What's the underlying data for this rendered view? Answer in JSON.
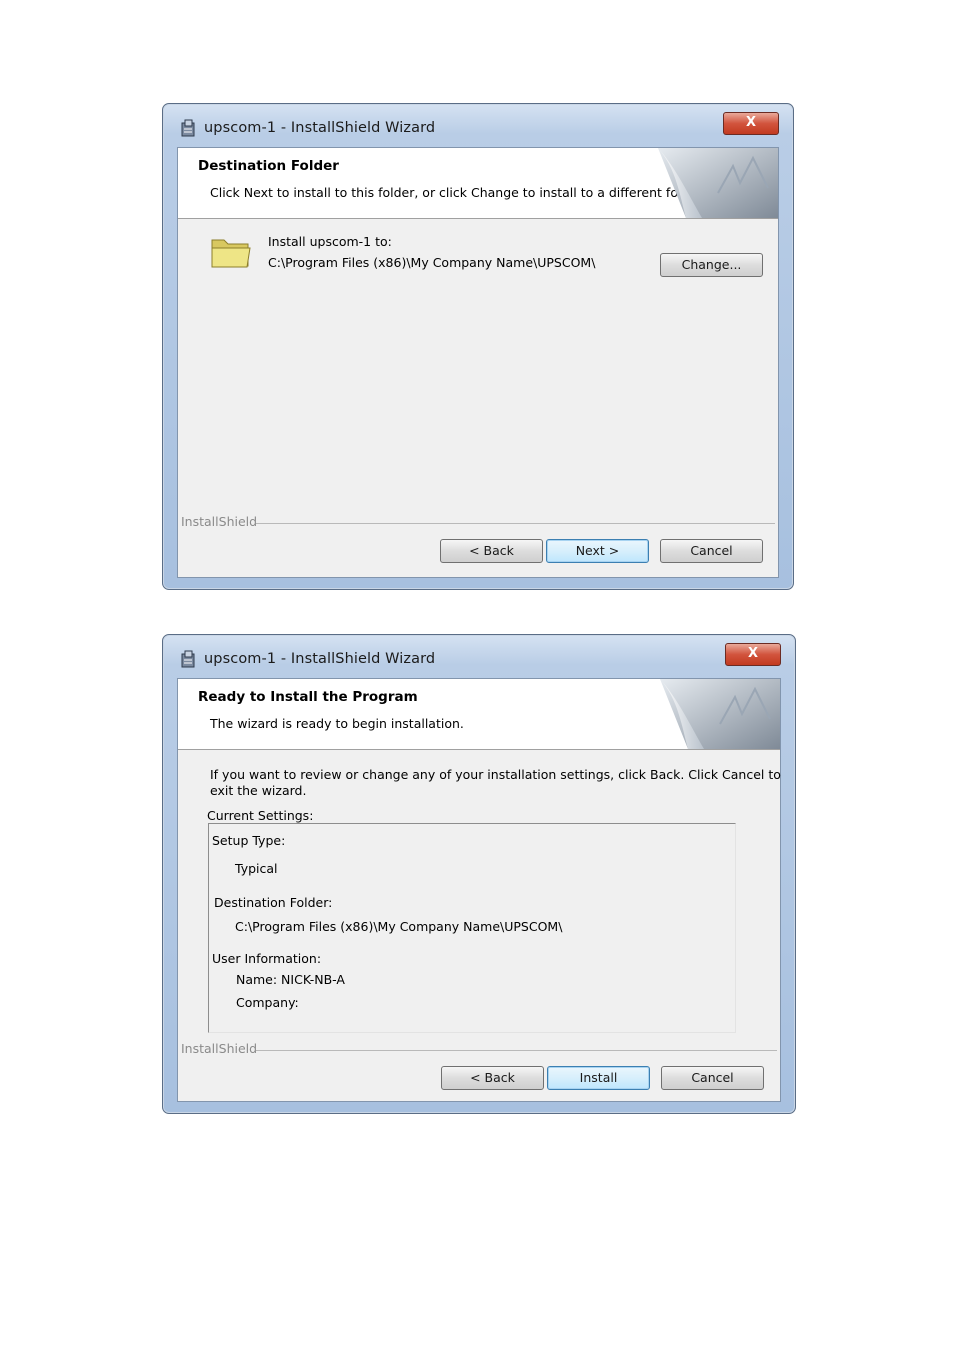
{
  "dialogs": [
    {
      "title": "upscom-1 - InstallShield Wizard",
      "close_label": "X",
      "banner": {
        "title": "Destination Folder",
        "subtitle": "Click Next to install to this folder, or click Change to install to a different folder."
      },
      "install_label": "Install upscom-1 to:",
      "install_path": "C:\\Program Files (x86)\\My Company Name\\UPSCOM\\",
      "change_label": "Change...",
      "brand": "InstallShield",
      "buttons": {
        "back": "< Back",
        "next": "Next >",
        "cancel": "Cancel"
      }
    },
    {
      "title": "upscom-1 - InstallShield Wizard",
      "close_label": "X",
      "banner": {
        "title": "Ready to Install the Program",
        "subtitle": "The wizard is ready to begin installation."
      },
      "intro_line1": "If you want to review or change any of your installation settings, click Back. Click Cancel to",
      "intro_line2": "exit the wizard.",
      "current_settings_label": "Current Settings:",
      "settings": {
        "setup_type_label": "Setup Type:",
        "setup_type_value": "Typical",
        "destination_label": "Destination Folder:",
        "destination_value": "C:\\Program Files (x86)\\My Company Name\\UPSCOM\\",
        "user_info_label": "User Information:",
        "name": "Name: NICK-NB-A",
        "company": "Company:"
      },
      "brand": "InstallShield",
      "buttons": {
        "back": "< Back",
        "install": "Install",
        "cancel": "Cancel"
      }
    }
  ]
}
